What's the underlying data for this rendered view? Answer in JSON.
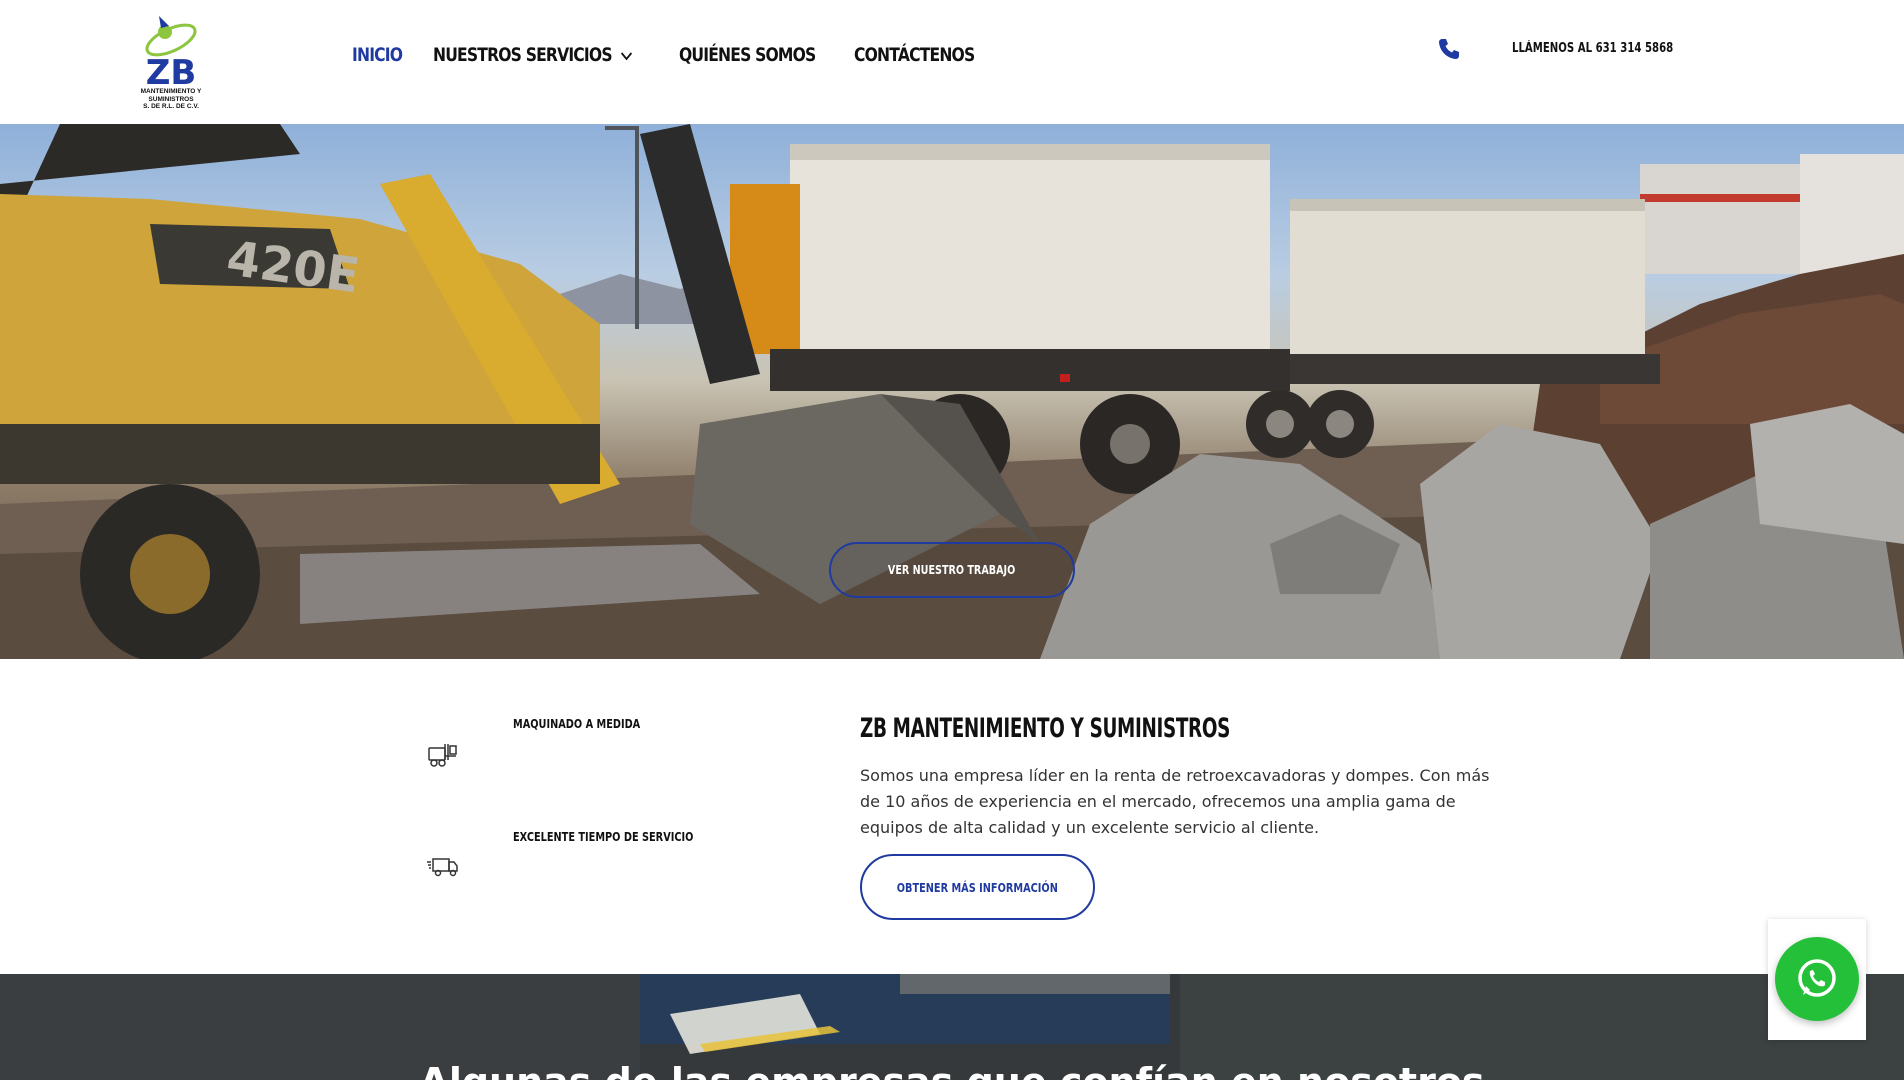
{
  "header": {
    "logo": {
      "mark": "ZB",
      "line1": "MANTENIMIENTO Y SUMINISTROS",
      "line2": "S. DE R.L. DE C.V."
    },
    "nav": [
      {
        "label": "INICIO",
        "active": true
      },
      {
        "label": "NUESTROS SERVICIOS",
        "has_dropdown": true
      },
      {
        "label": "QUIÉNES SOMOS"
      },
      {
        "label": "CONTÁCTENOS"
      }
    ],
    "phone_label": "LLÁMENOS AL 631 314 5868"
  },
  "hero": {
    "button_label": "VER NUESTRO TRABAJO",
    "machine_label": "420E"
  },
  "features": [
    {
      "title": "MAQUINADO A MEDIDA",
      "icon": "forklift-icon"
    },
    {
      "title": "EXCELENTE TIEMPO DE SERVICIO",
      "icon": "delivery-truck-icon"
    }
  ],
  "about": {
    "title": "ZB MANTENIMIENTO Y SUMINISTROS",
    "text": "Somos una empresa líder en la renta de retroexcavadoras y dompes. Con más de 10 años de experiencia en el mercado, ofrecemos una amplia gama de equipos de alta calidad y un excelente servicio al cliente.",
    "button_label": "OBTENER MÁS INFORMACIÓN"
  },
  "clients": {
    "title": "Algunas de las empresas que confían en nosotros"
  },
  "colors": {
    "brand_blue": "#1f3aa0",
    "logo_green": "#8cc63f",
    "whatsapp_green": "#25c03a"
  },
  "floating": {
    "icon": "whatsapp-icon"
  }
}
